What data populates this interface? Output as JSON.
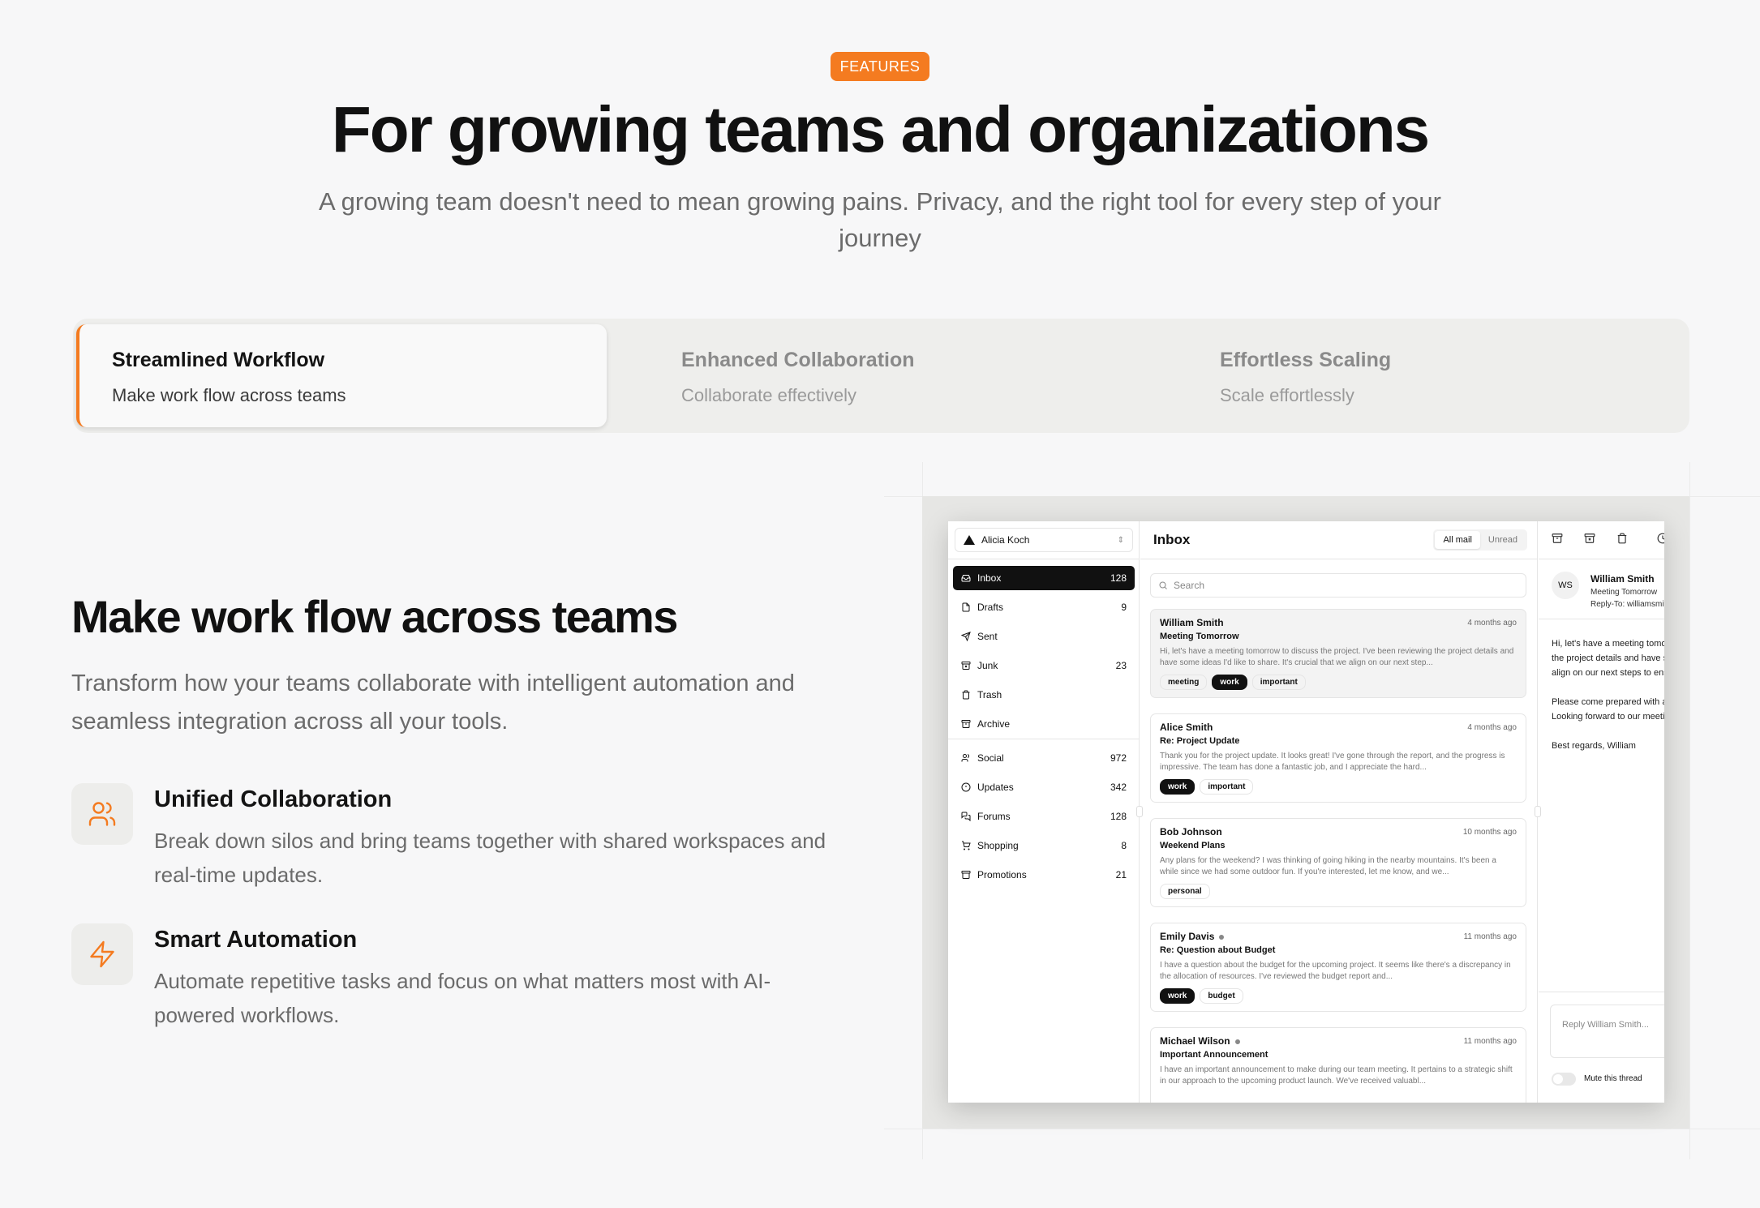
{
  "badge": "FEATURES",
  "headline": "For growing teams and organizations",
  "subheadline": "A growing team doesn't need to mean growing pains. Privacy, and the right tool for every step of your journey",
  "tabs": [
    {
      "title": "Streamlined Workflow",
      "subtitle": "Make work flow across teams",
      "active": true
    },
    {
      "title": "Enhanced Collaboration",
      "subtitle": "Collaborate effectively",
      "active": false
    },
    {
      "title": "Effortless Scaling",
      "subtitle": "Scale effortlessly",
      "active": false
    }
  ],
  "section": {
    "title": "Make work flow across teams",
    "description": "Transform how your teams collaborate with intelligent automation and seamless integration across all your tools."
  },
  "features": [
    {
      "icon": "users-icon",
      "title": "Unified Collaboration",
      "description": "Break down silos and bring teams together with shared workspaces and real-time updates."
    },
    {
      "icon": "zap-icon",
      "title": "Smart Automation",
      "description": "Automate repetitive tasks and focus on what matters most with AI-powered workflows."
    }
  ],
  "colors": {
    "accent": "#f47b20",
    "background": "#f7f7f8"
  },
  "mail_app": {
    "account": "Alicia Koch",
    "nav_primary": [
      {
        "label": "Inbox",
        "count": "128",
        "icon": "inbox-icon"
      },
      {
        "label": "Drafts",
        "count": "9",
        "icon": "file-icon"
      },
      {
        "label": "Sent",
        "count": "",
        "icon": "send-icon"
      },
      {
        "label": "Junk",
        "count": "23",
        "icon": "archive-x-icon"
      },
      {
        "label": "Trash",
        "count": "",
        "icon": "trash-icon"
      },
      {
        "label": "Archive",
        "count": "",
        "icon": "archive-icon"
      }
    ],
    "nav_secondary": [
      {
        "label": "Social",
        "count": "972",
        "icon": "users-icon"
      },
      {
        "label": "Updates",
        "count": "342",
        "icon": "alert-circle-icon"
      },
      {
        "label": "Forums",
        "count": "128",
        "icon": "message-icon"
      },
      {
        "label": "Shopping",
        "count": "8",
        "icon": "cart-icon"
      },
      {
        "label": "Promotions",
        "count": "21",
        "icon": "archive-icon"
      }
    ],
    "inbox_title": "Inbox",
    "filter_all": "All mail",
    "filter_unread": "Unread",
    "search_placeholder": "Search",
    "mails": [
      {
        "name": "William Smith",
        "date": "4 months ago",
        "subject": "Meeting Tomorrow",
        "body": "Hi, let's have a meeting tomorrow to discuss the project. I've been reviewing the project details and have some ideas I'd like to share. It's crucial that we align on our next step...",
        "tags": [
          "meeting",
          "work",
          "important"
        ],
        "unread": false
      },
      {
        "name": "Alice Smith",
        "date": "4 months ago",
        "subject": "Re: Project Update",
        "body": "Thank you for the project update. It looks great! I've gone through the report, and the progress is impressive. The team has done a fantastic job, and I appreciate the hard...",
        "tags": [
          "work",
          "important"
        ],
        "unread": false
      },
      {
        "name": "Bob Johnson",
        "date": "10 months ago",
        "subject": "Weekend Plans",
        "body": "Any plans for the weekend? I was thinking of going hiking in the nearby mountains. It's been a while since we had some outdoor fun. If you're interested, let me know, and we...",
        "tags": [
          "personal"
        ],
        "unread": false
      },
      {
        "name": "Emily Davis",
        "date": "11 months ago",
        "subject": "Re: Question about Budget",
        "body": "I have a question about the budget for the upcoming project. It seems like there's a discrepancy in the allocation of resources. I've reviewed the budget report and...",
        "tags": [
          "work",
          "budget"
        ],
        "unread": true
      },
      {
        "name": "Michael Wilson",
        "date": "11 months ago",
        "subject": "Important Announcement",
        "body": "I have an important announcement to make during our team meeting. It pertains to a strategic shift in our approach to the upcoming product launch. We've received valuabl...",
        "tags": [],
        "unread": true
      }
    ],
    "reader": {
      "initials": "WS",
      "name": "William Smith",
      "subject": "Meeting Tomorrow",
      "reply_to": "Reply-To: williamsmith@example.com",
      "body_1": "Hi, let's have a meeting tomorrow to discuss",
      "body_2": "the project details and have some ideas I'd like to",
      "body_3": "align on our next steps to ensure the project's success.",
      "body_4": "Please come prepared with any questions or insights.",
      "body_5": "Looking forward to our meeting!",
      "body_6": "Best regards, William",
      "reply_placeholder": "Reply William Smith...",
      "mute_label": "Mute this thread"
    }
  }
}
